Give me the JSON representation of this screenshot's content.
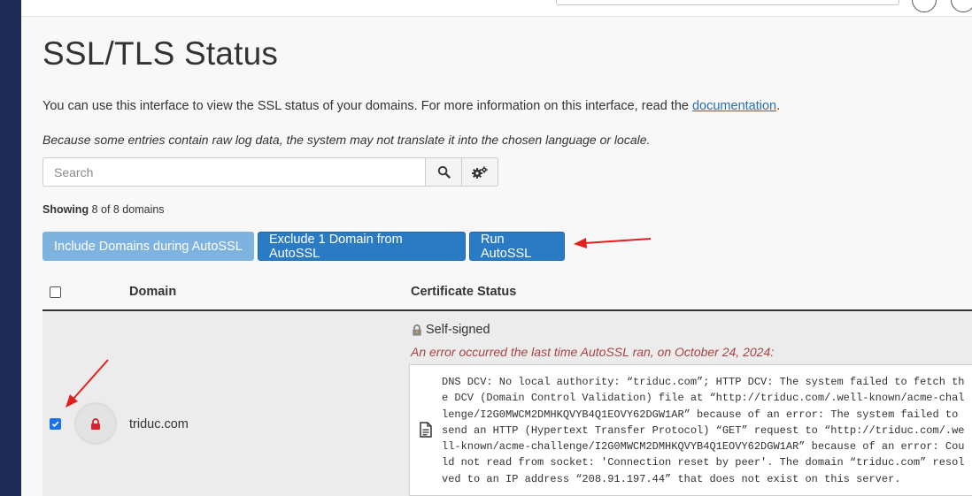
{
  "page": {
    "title": "SSL/TLS Status",
    "intro_text": "You can use this interface to view the SSL status of your domains. For more information on this interface, read the ",
    "intro_link": "documentation",
    "intro_end": ".",
    "note": "Because some entries contain raw log data, the system may not translate it into the chosen language or locale."
  },
  "search": {
    "placeholder": "Search"
  },
  "showing": {
    "label": "Showing",
    "count": "8 of 8 domains"
  },
  "actions": {
    "include_label": "Include Domains during AutoSSL",
    "exclude_label": "Exclude 1 Domain from AutoSSL",
    "run_label": "Run AutoSSL"
  },
  "table": {
    "col_domain": "Domain",
    "col_status": "Certificate Status",
    "rows": [
      {
        "domain": "triduc.com",
        "status": "Self-signed",
        "error": "An error occurred the last time AutoSSL ran, on October 24, 2024:",
        "log": "DNS DCV: No local authority: “triduc.com”; HTTP DCV: The system failed to fetch the DCV (Domain Control Validation) file at “http://triduc.com/.well-known/acme-challenge/I2G0MWCM2DMHKQVYB4Q1EOVY62DGW1AR” because of an error: The system failed to send an HTTP (Hypertext Transfer Protocol) “GET” request to “http://triduc.com/.well-known/acme-challenge/I2G0MWCM2DMHKQVYB4Q1EOVY62DGW1AR” because of an error: Could not read from socket: 'Connection reset by peer'. The domain “triduc.com” resolved to an IP address “208.91.197.44” that does not exist on this server.",
        "checked": true
      }
    ]
  },
  "icons": {
    "search": "search-icon",
    "settings": "gears-icon",
    "lock": "lock-icon",
    "document": "document-icon"
  },
  "colors": {
    "primary": "#2b7bc4",
    "primary_disabled": "#7eb3e0",
    "error": "#a94442",
    "lock": "#d9232e",
    "annotation": "#e0201d"
  }
}
